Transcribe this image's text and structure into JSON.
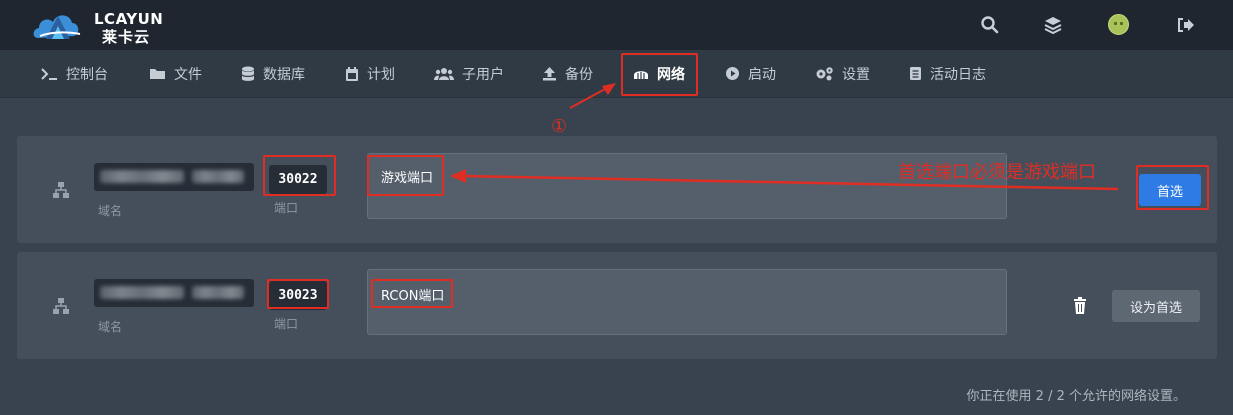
{
  "brand": {
    "name_en": "LCAYUN",
    "name_cn": "莱卡云"
  },
  "topbar": {
    "icons": [
      "search-icon",
      "layers-icon",
      "avatar",
      "logout-icon"
    ]
  },
  "nav": {
    "items": [
      {
        "label": "控制台",
        "icon": "terminal-icon"
      },
      {
        "label": "文件",
        "icon": "folder-icon"
      },
      {
        "label": "数据库",
        "icon": "database-icon"
      },
      {
        "label": "计划",
        "icon": "calendar-icon"
      },
      {
        "label": "子用户",
        "icon": "users-icon"
      },
      {
        "label": "备份",
        "icon": "upload-icon"
      },
      {
        "label": "网络",
        "icon": "network-icon",
        "active": true
      },
      {
        "label": "启动",
        "icon": "play-icon"
      },
      {
        "label": "设置",
        "icon": "gears-icon"
      },
      {
        "label": "活动日志",
        "icon": "log-icon"
      }
    ]
  },
  "allocations": [
    {
      "domain_label": "域名",
      "port": "30022",
      "port_label": "端口",
      "notes": "游戏端口",
      "primary_button": "首选"
    },
    {
      "domain_label": "域名",
      "port": "30023",
      "port_label": "端口",
      "notes": "RCON端口",
      "set_primary_button": "设为首选"
    }
  ],
  "annotations": {
    "step_marker": "①",
    "callout": "首选端口必须是游戏端口"
  },
  "footer": {
    "usage_text": "你正在使用 2 / 2 个允许的网络设置。"
  },
  "colors": {
    "topbar_bg": "#1f2630",
    "nav_bg": "#303a45",
    "page_bg": "#39434f",
    "card_bg": "#454f5b",
    "primary": "#2f7be5",
    "annotation_red": "#e02d24"
  }
}
